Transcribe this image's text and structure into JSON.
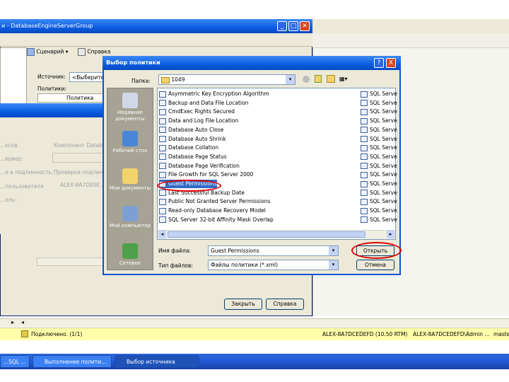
{
  "background_window": {
    "title": "и - DatabaseEngineServerGroup",
    "toolbar_label": "Сценарий",
    "toolbar_label2": "Справка",
    "source_label": "Источник:",
    "source_value": "<Выберите...",
    "policies_label": "Политики:",
    "policies_col": "Политика",
    "fields": [
      {
        "label": "...ксов",
        "value": "Компонент Databa..."
      },
      {
        "label": "...ервер:",
        "value": ""
      },
      {
        "label": "...и в подлинность:",
        "value": "Проверка подлинн..."
      },
      {
        "label": "...пользователя",
        "value": "ALEX-8A7DE0E..."
      },
      {
        "label": "...оль:",
        "value": ""
      }
    ],
    "close_button": "Закрыть",
    "help_button": "Справка"
  },
  "dialog": {
    "title": "Выбор политики",
    "help_btn": "?",
    "close_btn": "X",
    "folder_label": "Папка:",
    "folder_value": "1049",
    "places": [
      {
        "label": "Недавние документы",
        "color": "#d0d8e8"
      },
      {
        "label": "Рабочий стол",
        "color": "#4a86d8"
      },
      {
        "label": "Мои документы",
        "color": "#f2d36b"
      },
      {
        "label": "Мой компьютер",
        "color": "#7e9fd1"
      },
      {
        "label": "Сетевое",
        "color": "#4fa04a"
      }
    ],
    "files_col1": [
      "Asymmetric Key Encryption Algorithm",
      "Backup and Data File Location",
      "CmdExec Rights Secured",
      "Data and Log File Location",
      "Database Auto Close",
      "Database Auto Shrink",
      "Database Collation",
      "Database Page Status",
      "Database Page Verification",
      "File Growth for SQL Server 2000",
      "Guest Permissions",
      "Last Successful Backup Date",
      "Public Not Granted Server Permissions",
      "Read-only Database Recovery Model",
      "SQL Server 32-bit Affinity Mask Overlap"
    ],
    "files_col2": "SQL Serve",
    "filename_label": "Имя файла:",
    "filename_value": "Guest Permissions",
    "filetype_label": "Тип файлов:",
    "filetype_value": "Файлы политики (*.xml)",
    "open_button": "Открыть",
    "cancel_button": "Отмена"
  },
  "status_bar": {
    "connected": "Подключено. (1/1)",
    "server": "ALEX-8A7DCEDEFD (10.50 RTM)",
    "user": "ALEX-8A7DCEDEFD\\Admin ...",
    "db": "maste"
  },
  "taskbar": {
    "items": [
      "...SQL ...",
      "Выполнение полити...",
      "Выбор источника"
    ]
  }
}
